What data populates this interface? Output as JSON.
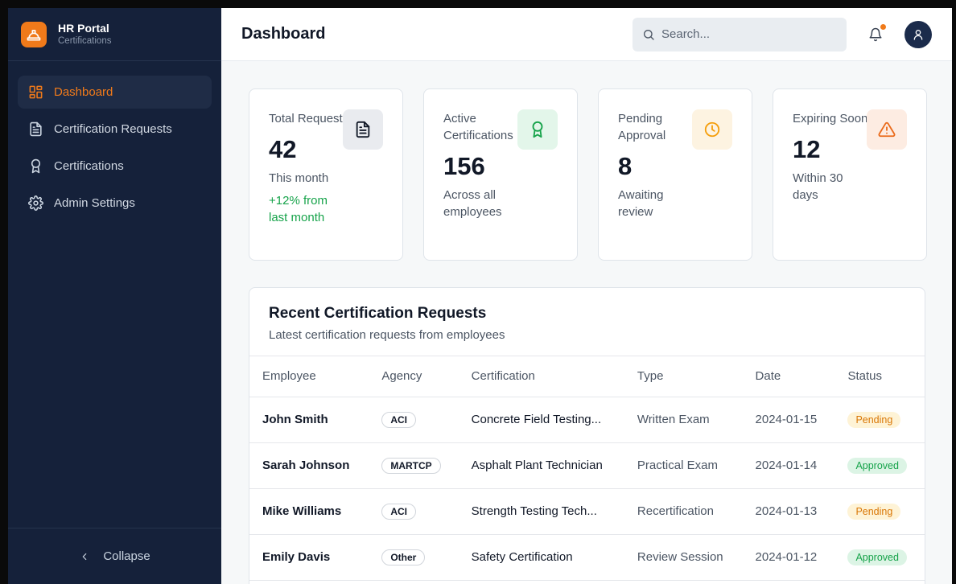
{
  "brand": {
    "title": "HR Portal",
    "subtitle": "Certifications"
  },
  "sidebar": {
    "items": [
      {
        "label": "Dashboard",
        "icon": "dashboard-icon",
        "active": true
      },
      {
        "label": "Certification Requests",
        "icon": "document-icon"
      },
      {
        "label": "Certifications",
        "icon": "award-icon"
      },
      {
        "label": "Admin Settings",
        "icon": "gear-icon"
      }
    ],
    "collapse_label": "Collapse"
  },
  "header": {
    "title": "Dashboard",
    "search_placeholder": "Search..."
  },
  "stats": [
    {
      "label": "Total Requests",
      "value": "42",
      "sub": "This month",
      "trend": "+12% from last month",
      "icon": "document-icon",
      "color": "#111827",
      "bg": "#e9ebef"
    },
    {
      "label": "Active Certifications",
      "value": "156",
      "sub": "Across all employees",
      "icon": "award-icon",
      "color": "#16a34a",
      "bg": "#e3f6ea"
    },
    {
      "label": "Pending Approval",
      "value": "8",
      "sub": "Awaiting review",
      "icon": "clock-icon",
      "color": "#f59e0b",
      "bg": "#fdf3e1"
    },
    {
      "label": "Expiring Soon",
      "value": "12",
      "sub": "Within 30 days",
      "icon": "warning-icon",
      "color": "#ea6a1a",
      "bg": "#fdece2"
    }
  ],
  "table": {
    "title": "Recent Certification Requests",
    "subtitle": "Latest certification requests from employees",
    "columns": [
      "Employee",
      "Agency",
      "Certification",
      "Type",
      "Date",
      "Status"
    ],
    "rows": [
      {
        "employee": "John Smith",
        "agency": "ACI",
        "certification": "Concrete Field Testing...",
        "type": "Written Exam",
        "date": "2024-01-15",
        "status": "Pending"
      },
      {
        "employee": "Sarah Johnson",
        "agency": "MARTCP",
        "certification": "Asphalt Plant Technician",
        "type": "Practical Exam",
        "date": "2024-01-14",
        "status": "Approved"
      },
      {
        "employee": "Mike Williams",
        "agency": "ACI",
        "certification": "Strength Testing Tech...",
        "type": "Recertification",
        "date": "2024-01-13",
        "status": "Pending"
      },
      {
        "employee": "Emily Davis",
        "agency": "Other",
        "certification": "Safety Certification",
        "type": "Review Session",
        "date": "2024-01-12",
        "status": "Approved"
      }
    ]
  },
  "colors": {
    "accent": "#f07a1a",
    "sidebar": "#15213a",
    "success": "#16a34a",
    "warning": "#d97706"
  }
}
